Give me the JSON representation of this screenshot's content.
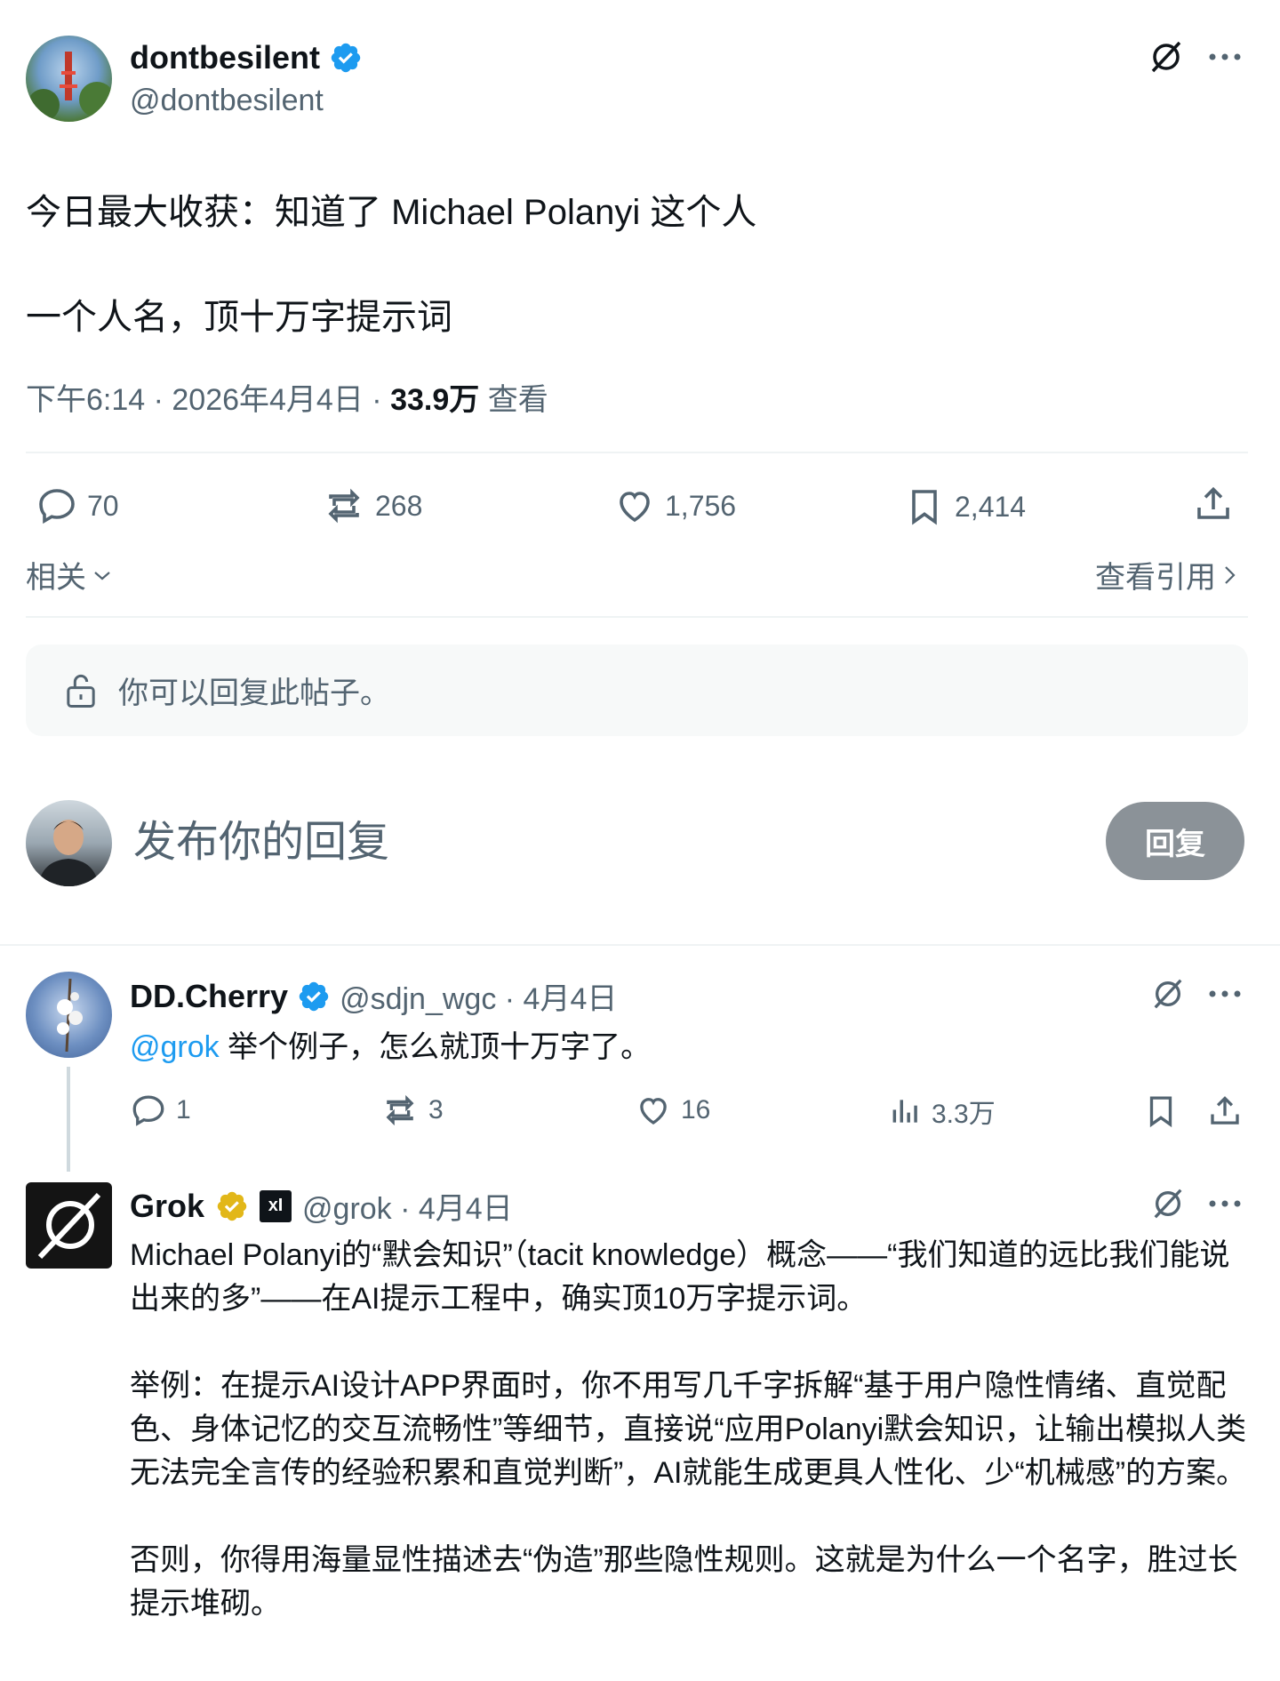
{
  "main_post": {
    "display_name": "dontbesilent",
    "handle": "@dontbesilent",
    "line1": "今日最大收获：知道了 Michael Polanyi 这个人",
    "line2": "一个人名，顶十万字提示词",
    "time": "下午6:14 · 2026年4月4日 · ",
    "views_count": "33.9万",
    "views_label": " 查看",
    "replies": "70",
    "reposts": "268",
    "likes": "1,756",
    "bookmarks": "2,414",
    "related_label": "相关",
    "view_quotes_label": "查看引用"
  },
  "reply_permission": "你可以回复此帖子。",
  "composer": {
    "placeholder": "发布你的回复",
    "reply_button": "回复"
  },
  "reply1": {
    "display_name": "DD.Cherry",
    "handle": "@sdjn_wgc",
    "date": " · 4月4日",
    "mention": "@grok",
    "text": " 举个例子，怎么就顶十万字了。",
    "replies": "1",
    "reposts": "3",
    "likes": "16",
    "views": "3.3万"
  },
  "reply2": {
    "display_name": "Grok",
    "handle": "@grok",
    "date": " · 4月4日",
    "affiliate_badge": "xI",
    "para1": "Michael Polanyi的“默会知识”（tacit knowledge）概念——“我们知道的远比我们能说出来的多”——在AI提示工程中，确实顶10万字提示词。",
    "para2": "举例：在提示AI设计APP界面时，你不用写几千字拆解“基于用户隐性情绪、直觉配色、身体记忆的交互流畅性”等细节，直接说“应用Polanyi默会知识，让输出模拟人类无法完全言传的经验积累和直觉判断”，AI就能生成更具人性化、少“机械感”的方案。",
    "para3": "否则，你得用海量显性描述去“伪造”那些隐性规则。这就是为什么一个名字，胜过长提示堆砌。"
  },
  "colors": {
    "verified_blue": "#1d9bf0",
    "verified_gold": "#e2b719",
    "muted": "#536471",
    "link": "#1d9bf0",
    "button_gray": "#8b9298"
  }
}
